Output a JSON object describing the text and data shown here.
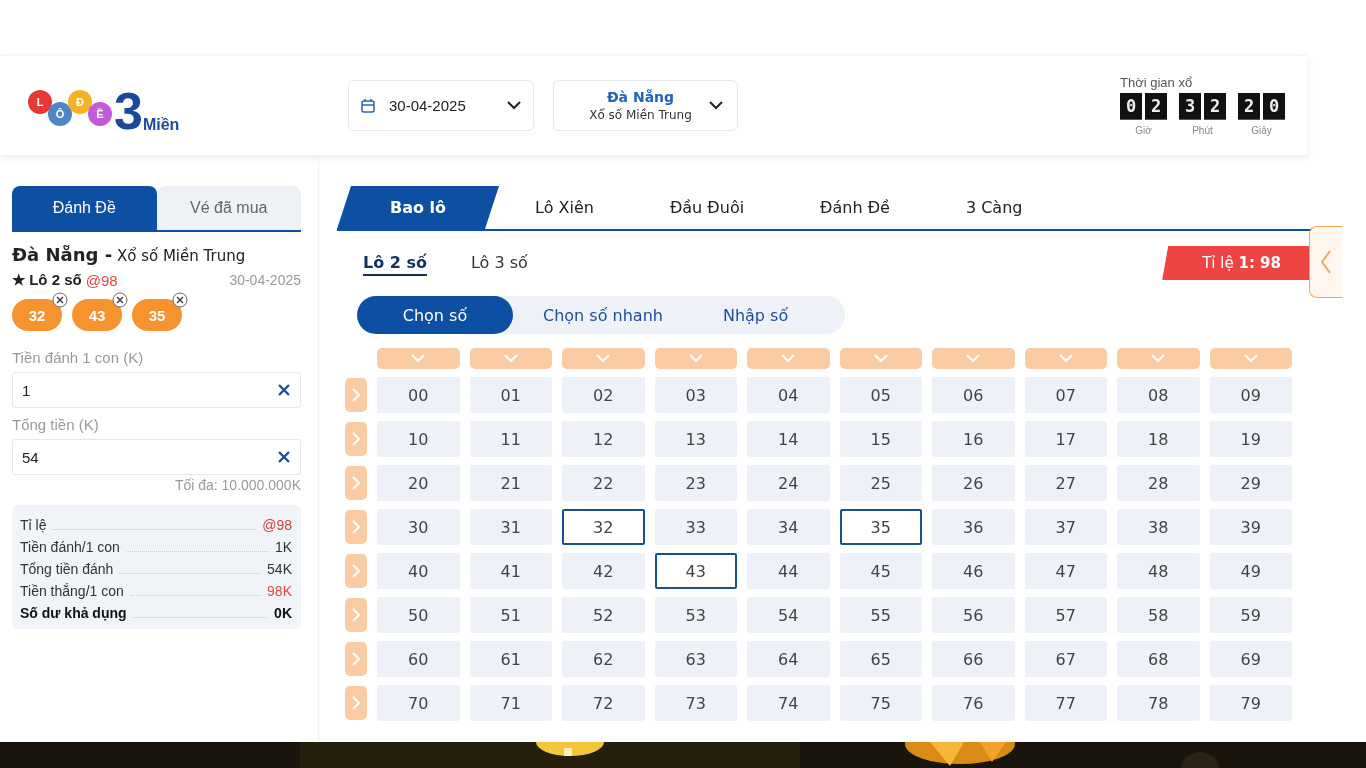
{
  "header": {
    "logo": {
      "balls": [
        "L",
        "Ô",
        "Đ",
        "Ề"
      ],
      "numeral": "3",
      "word": "Miền"
    },
    "date_select": {
      "value": "30-04-2025"
    },
    "region_select": {
      "province": "Đà Nẵng",
      "lottery": "Xổ số Miền Trung"
    },
    "countdown": {
      "label": "Thời gian xổ",
      "units": [
        {
          "digits": [
            "0",
            "2"
          ],
          "label": "Giờ"
        },
        {
          "digits": [
            "3",
            "2"
          ],
          "label": "Phút"
        },
        {
          "digits": [
            "2",
            "0"
          ],
          "label": "Giây"
        }
      ]
    }
  },
  "bet_slip": {
    "tabs": [
      {
        "label": "Đánh Đề",
        "selected": true
      },
      {
        "label": "Vé đã mua",
        "selected": false
      }
    ],
    "title": "**Đà Nẵng -** Xổ số Miền Trung",
    "bet_type": "★ Lô 2 số",
    "rate": "@98",
    "date": "30-04-2025",
    "chips": [
      "32",
      "43",
      "35"
    ],
    "fields": [
      {
        "label": "Tiền đánh 1 con (K)",
        "value": "1"
      },
      {
        "label": "Tổng tiền (K)",
        "value": "54"
      }
    ],
    "max_note": "Tối đa: 10.000.000K",
    "summary": [
      {
        "label": "Tỉ lệ",
        "value": "@98",
        "kind": "rate"
      },
      {
        "label": "Tiền đánh/1 con",
        "value": "1K",
        "kind": "plain"
      },
      {
        "label": "Tổng tiền đánh",
        "value": "54K",
        "kind": "plain"
      },
      {
        "label": "Tiền thắng/1 con",
        "value": "98K",
        "kind": "win"
      },
      {
        "label": "Số dư khả dụng",
        "value": "0K",
        "kind": "total"
      }
    ]
  },
  "main": {
    "game_tabs": [
      {
        "label": "Bao lô",
        "selected": true
      },
      {
        "label": "Lô Xiên",
        "selected": false
      },
      {
        "label": "Đầu Đuôi",
        "selected": false
      },
      {
        "label": "Đánh Đề",
        "selected": false
      },
      {
        "label": "3 Càng",
        "selected": false
      }
    ],
    "sub_tabs": [
      {
        "label": "Lô 2 số",
        "selected": true
      },
      {
        "label": "Lô 3 số",
        "selected": false
      }
    ],
    "ratio_badge": "Tỉ lệ **1: 98**",
    "modes": [
      {
        "label": "Chọn số",
        "selected": true
      },
      {
        "label": "Chọn số nhanh",
        "selected": false
      },
      {
        "label": "Nhập số",
        "selected": false
      }
    ],
    "number_grid": [
      [
        {
          "number": "00",
          "selected": false
        },
        {
          "number": "01",
          "selected": false
        },
        {
          "number": "02",
          "selected": false
        },
        {
          "number": "03",
          "selected": false
        },
        {
          "number": "04",
          "selected": false
        },
        {
          "number": "05",
          "selected": false
        },
        {
          "number": "06",
          "selected": false
        },
        {
          "number": "07",
          "selected": false
        },
        {
          "number": "08",
          "selected": false
        },
        {
          "number": "09",
          "selected": false
        }
      ],
      [
        {
          "number": "10",
          "selected": false
        },
        {
          "number": "11",
          "selected": false
        },
        {
          "number": "12",
          "selected": false
        },
        {
          "number": "13",
          "selected": false
        },
        {
          "number": "14",
          "selected": false
        },
        {
          "number": "15",
          "selected": false
        },
        {
          "number": "16",
          "selected": false
        },
        {
          "number": "17",
          "selected": false
        },
        {
          "number": "18",
          "selected": false
        },
        {
          "number": "19",
          "selected": false
        }
      ],
      [
        {
          "number": "20",
          "selected": false
        },
        {
          "number": "21",
          "selected": false
        },
        {
          "number": "22",
          "selected": false
        },
        {
          "number": "23",
          "selected": false
        },
        {
          "number": "24",
          "selected": false
        },
        {
          "number": "25",
          "selected": false
        },
        {
          "number": "26",
          "selected": false
        },
        {
          "number": "27",
          "selected": false
        },
        {
          "number": "28",
          "selected": false
        },
        {
          "number": "29",
          "selected": false
        }
      ],
      [
        {
          "number": "30",
          "selected": false
        },
        {
          "number": "31",
          "selected": false
        },
        {
          "number": "32",
          "selected": true
        },
        {
          "number": "33",
          "selected": false
        },
        {
          "number": "34",
          "selected": false
        },
        {
          "number": "35",
          "selected": true
        },
        {
          "number": "36",
          "selected": false
        },
        {
          "number": "37",
          "selected": false
        },
        {
          "number": "38",
          "selected": false
        },
        {
          "number": "39",
          "selected": false
        }
      ],
      [
        {
          "number": "40",
          "selected": false
        },
        {
          "number": "41",
          "selected": false
        },
        {
          "number": "42",
          "selected": false
        },
        {
          "number": "43",
          "selected": true
        },
        {
          "number": "44",
          "selected": false
        },
        {
          "number": "45",
          "selected": false
        },
        {
          "number": "46",
          "selected": false
        },
        {
          "number": "47",
          "selected": false
        },
        {
          "number": "48",
          "selected": false
        },
        {
          "number": "49",
          "selected": false
        }
      ],
      [
        {
          "number": "50",
          "selected": false
        },
        {
          "number": "51",
          "selected": false
        },
        {
          "number": "52",
          "selected": false
        },
        {
          "number": "53",
          "selected": false
        },
        {
          "number": "54",
          "selected": false
        },
        {
          "number": "55",
          "selected": false
        },
        {
          "number": "56",
          "selected": false
        },
        {
          "number": "57",
          "selected": false
        },
        {
          "number": "58",
          "selected": false
        },
        {
          "number": "59",
          "selected": false
        }
      ],
      [
        {
          "number": "60",
          "selected": false
        },
        {
          "number": "61",
          "selected": false
        },
        {
          "number": "62",
          "selected": false
        },
        {
          "number": "63",
          "selected": false
        },
        {
          "number": "64",
          "selected": false
        },
        {
          "number": "65",
          "selected": false
        },
        {
          "number": "66",
          "selected": false
        },
        {
          "number": "67",
          "selected": false
        },
        {
          "number": "68",
          "selected": false
        },
        {
          "number": "69",
          "selected": false
        }
      ],
      [
        {
          "number": "70",
          "selected": false
        },
        {
          "number": "71",
          "selected": false
        },
        {
          "number": "72",
          "selected": false
        },
        {
          "number": "73",
          "selected": false
        },
        {
          "number": "74",
          "selected": false
        },
        {
          "number": "75",
          "selected": false
        },
        {
          "number": "76",
          "selected": false
        },
        {
          "number": "77",
          "selected": false
        },
        {
          "number": "78",
          "selected": false
        },
        {
          "number": "79",
          "selected": false
        }
      ]
    ]
  }
}
